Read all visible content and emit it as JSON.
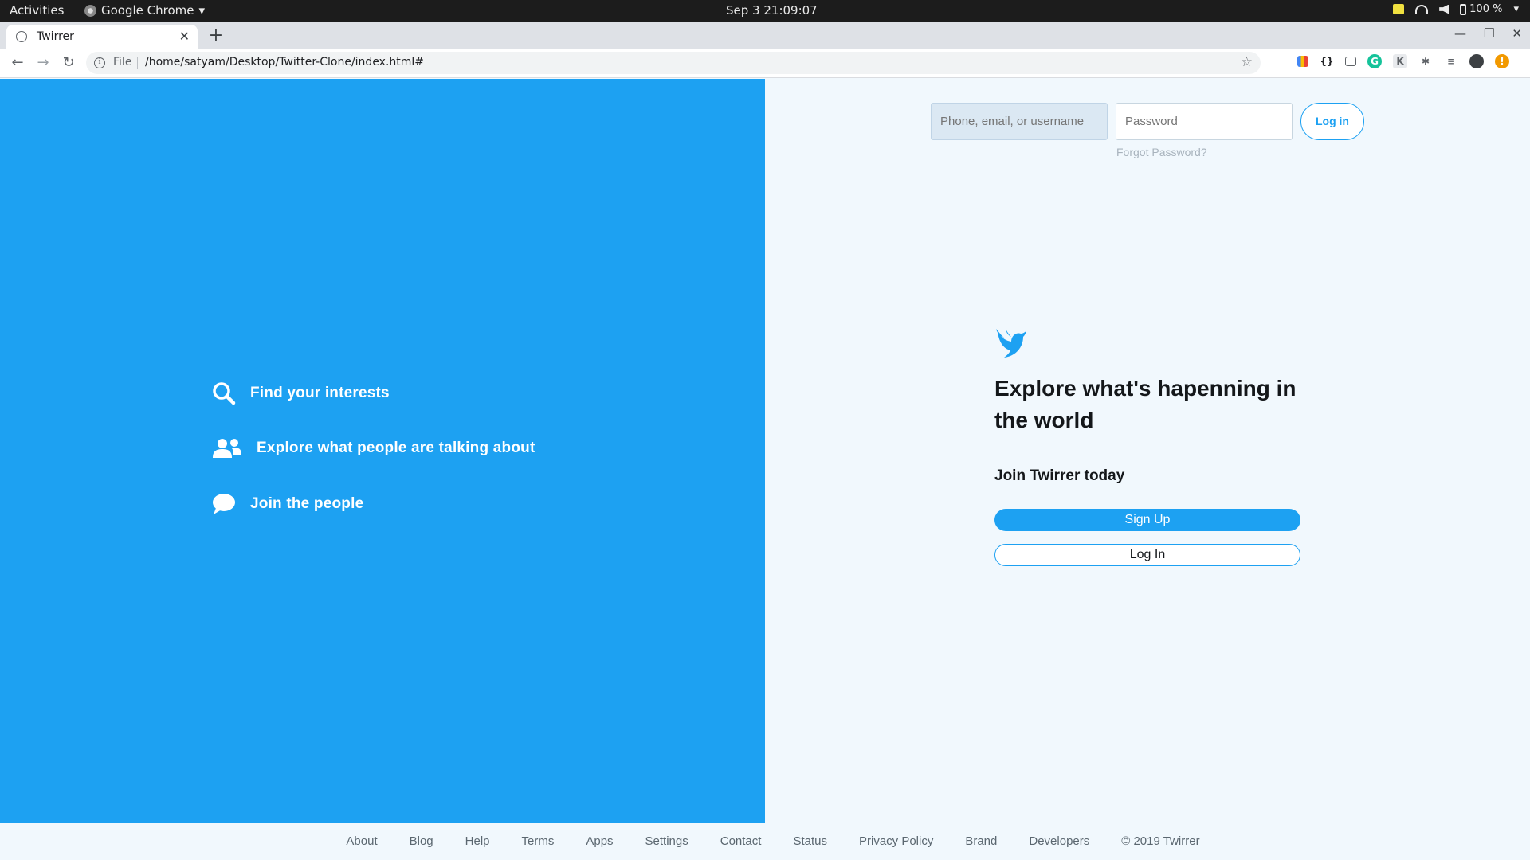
{
  "system_bar": {
    "activities": "Activities",
    "app_name": "Google Chrome",
    "clock": "Sep 3  21:09:07",
    "battery": "100 %"
  },
  "browser": {
    "tab_title": "Twirrer",
    "scheme_label": "File",
    "url": "/home/satyam/Desktop/Twitter-Clone/index.html#"
  },
  "features": [
    {
      "icon": "search-icon",
      "label": "Find your interests"
    },
    {
      "icon": "users-icon",
      "label": "Explore what people are talking about"
    },
    {
      "icon": "chat-bubble-icon",
      "label": "Join the people"
    }
  ],
  "login": {
    "username_placeholder": "Phone, email, or username",
    "password_placeholder": "Password",
    "button": "Log in",
    "forgot": "Forgot Password?"
  },
  "hero": {
    "headline": "Explore what's hapenning in the world",
    "subhead": "Join Twirrer today",
    "signup": "Sign Up",
    "login": "Log In"
  },
  "footer": {
    "links": [
      "About",
      "Blog",
      "Help",
      "Terms",
      "Apps",
      "Settings",
      "Contact",
      "Status",
      "Privacy Policy",
      "Brand",
      "Developers"
    ],
    "copyright": "© 2019 Twirrer"
  },
  "colors": {
    "brand": "#1da1f2",
    "page_bg": "#f1f8fd",
    "text": "#14171a"
  }
}
